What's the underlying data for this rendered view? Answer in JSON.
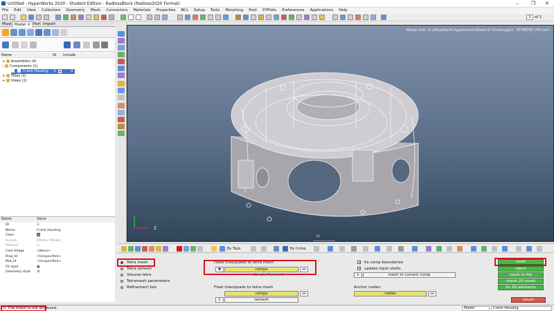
{
  "window": {
    "title": "Untitled - HyperWorks 2020 - Student Edition - RadiossBlock (Radioss2020 Format)",
    "minimize_icon": "minimize-icon",
    "maximize_icon": "maximize-icon",
    "close_icon": "close-icon"
  },
  "menu": [
    "File",
    "Edit",
    "View",
    "Collectors",
    "Geometry",
    "Mesh",
    "Connectors",
    "Materials",
    "Properties",
    "BCs",
    "Setup",
    "Tools",
    "Morphing",
    "Post",
    "XYPlots",
    "Preferences",
    "Applications",
    "Help"
  ],
  "toolbar": {
    "page_current": "1",
    "page_total_label": "of 1"
  },
  "left_panel": {
    "tabs": [
      "Mask",
      "Model",
      "Part",
      "Import"
    ],
    "tree_headers": {
      "name": "Name",
      "id": "ID",
      "include": "Include"
    },
    "tree": [
      {
        "label": "Assemblies (4)"
      },
      {
        "label": "Components (1)"
      },
      {
        "label": "Crank Housing",
        "id": "3",
        "include": "0"
      },
      {
        "label": "Titles (1)"
      },
      {
        "label": "Views (1)"
      }
    ],
    "properties_headers": {
      "name": "Name",
      "value": "Value"
    },
    "properties": [
      {
        "name": "ID",
        "value": "3"
      },
      {
        "name": "Name",
        "value": "Crank Housing"
      },
      {
        "name": "Color",
        "value": ""
      },
      {
        "name": "Include",
        "value": "[Master Model]"
      },
      {
        "name": "Defined",
        "value": ""
      },
      {
        "name": "Card Image",
        "value": "<None>"
      },
      {
        "name": "Prop_Id",
        "value": "<Unspecified>"
      },
      {
        "name": "Mat_Id",
        "value": "<Unspecified>"
      },
      {
        "name": "FE style",
        "value": ""
      },
      {
        "name": "Geometry style",
        "value": ""
      }
    ],
    "component_color": "#8a82d6"
  },
  "viewport": {
    "model_info": "Model Info: G:/#Aadity/4.Hypermesh/Week-8 Challenge/2. TETMESH_PM.hm*",
    "triad_z": "Z",
    "scale_label": "20"
  },
  "viewport_toolbar": {
    "by_topo": "By Topo",
    "by_comp": "By Comp"
  },
  "panel": {
    "radios": [
      "Tetra mesh",
      "Tetra remesh",
      "Volume tetra",
      "Tetramesh parameters",
      "Refinement box"
    ],
    "selected_radio": "Tetra mesh",
    "fixed_label": "Fixed trias/quads to tetra mesh",
    "fixed_selector": "comps",
    "fixed_mode": "Simple Pyramid",
    "float_label": "Float trias/quads to tetra mesh",
    "float_selector": "comps",
    "float_action": "remesh",
    "checkboxes": [
      "fix comp boundaries",
      "update input shells"
    ],
    "mesh_to_current_comp": "mesh to current comp",
    "anchor_label": "Anchor nodes:",
    "anchor_selector": "nodes",
    "actions": [
      "mesh",
      "reject",
      "mesh to file",
      "check 2D mesh",
      "fix 3D elements"
    ],
    "return_label": "return"
  },
  "status": {
    "message": "The mesh is not enclosed.",
    "field_model": "Model",
    "field_comp": "Crank Housing"
  },
  "colors": {
    "accent_red": "#d8141b",
    "green_button": "#4bb54c",
    "yellow_field": "#e7e36a",
    "viewport_top": "#8193aa",
    "viewport_bottom": "#304559"
  }
}
